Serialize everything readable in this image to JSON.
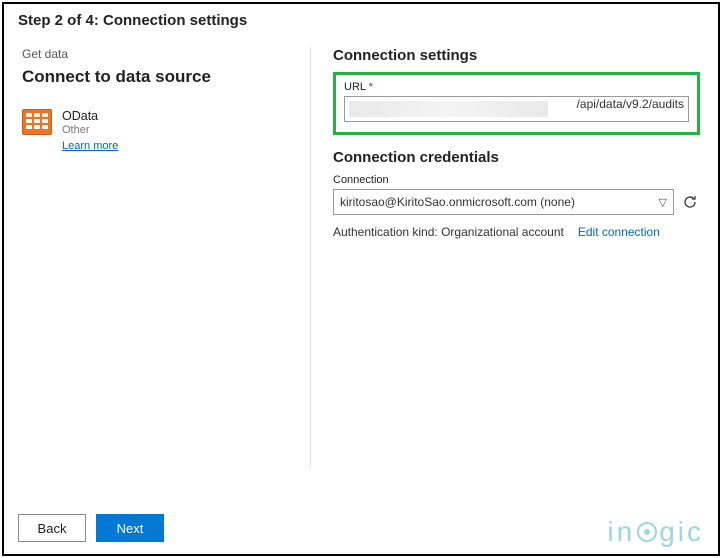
{
  "step_title": "Step 2 of 4: Connection settings",
  "get_data": "Get data",
  "connect_title": "Connect to data source",
  "source": {
    "name": "OData",
    "sub": "Other",
    "learn": "Learn more"
  },
  "settings": {
    "heading": "Connection settings",
    "url_label": "URL",
    "required": "*",
    "url_value": "/api/data/v9.2/audits"
  },
  "credentials": {
    "heading": "Connection credentials",
    "conn_label": "Connection",
    "conn_value": "kiritosao@KiritoSao.onmicrosoft.com (none)",
    "auth_kind_label": "Authentication kind:",
    "auth_kind_value": "Organizational account",
    "edit": "Edit connection"
  },
  "buttons": {
    "back": "Back",
    "next": "Next"
  },
  "watermark": {
    "pre": "in",
    "post": "gic"
  }
}
